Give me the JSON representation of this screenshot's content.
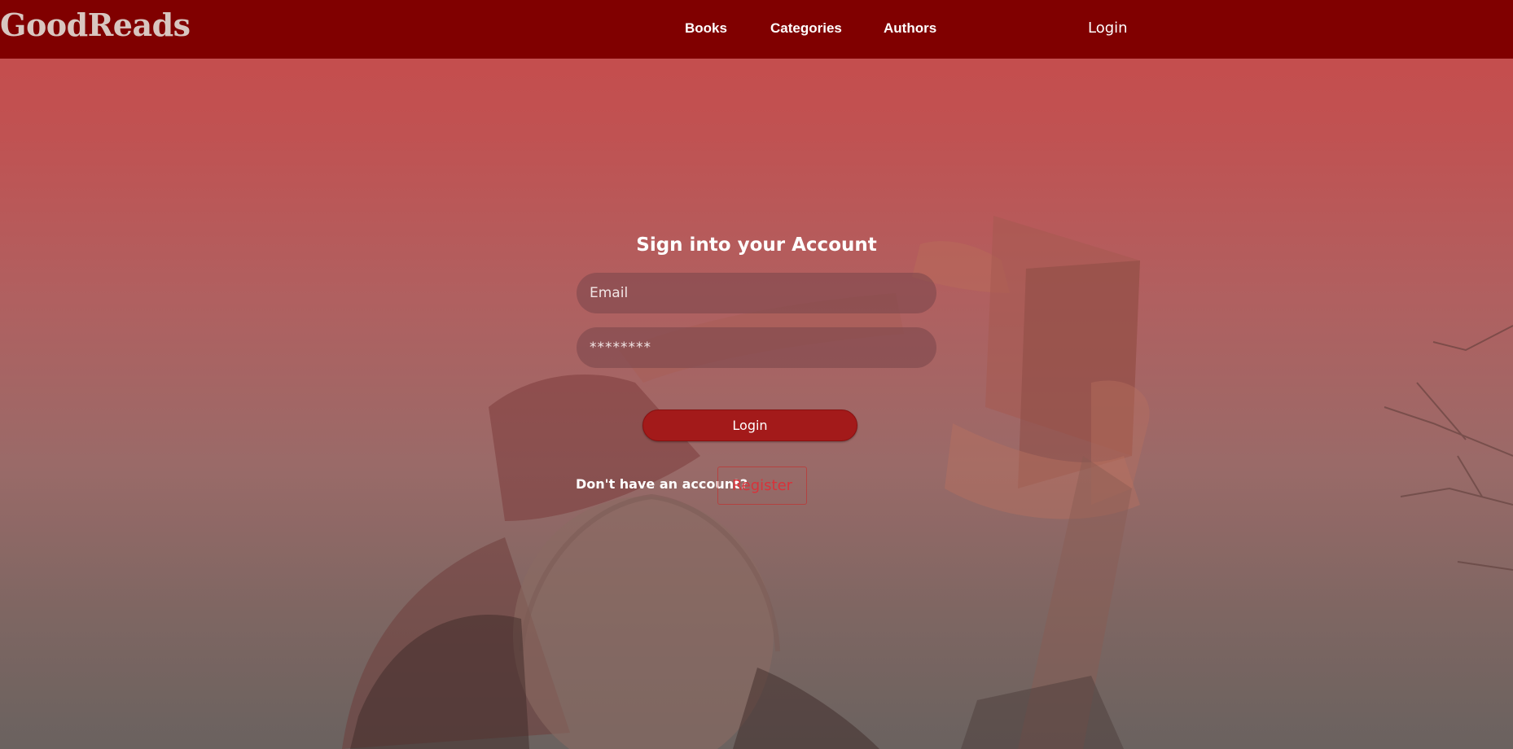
{
  "navbar": {
    "brand": "GoodReads",
    "links": [
      "Books",
      "Categories",
      "Authors"
    ],
    "login": "Login"
  },
  "form": {
    "title": "Sign into your Account",
    "email_placeholder": "Email",
    "password_placeholder": "********",
    "submit_label": "Login",
    "no_account_text": "Don't have an account?",
    "register_label": "Register"
  },
  "colors": {
    "navbar_bg": "#800000",
    "brand_text": "#d8c6c0",
    "login_button": "#a31a1a",
    "register_text": "#d9323a"
  }
}
